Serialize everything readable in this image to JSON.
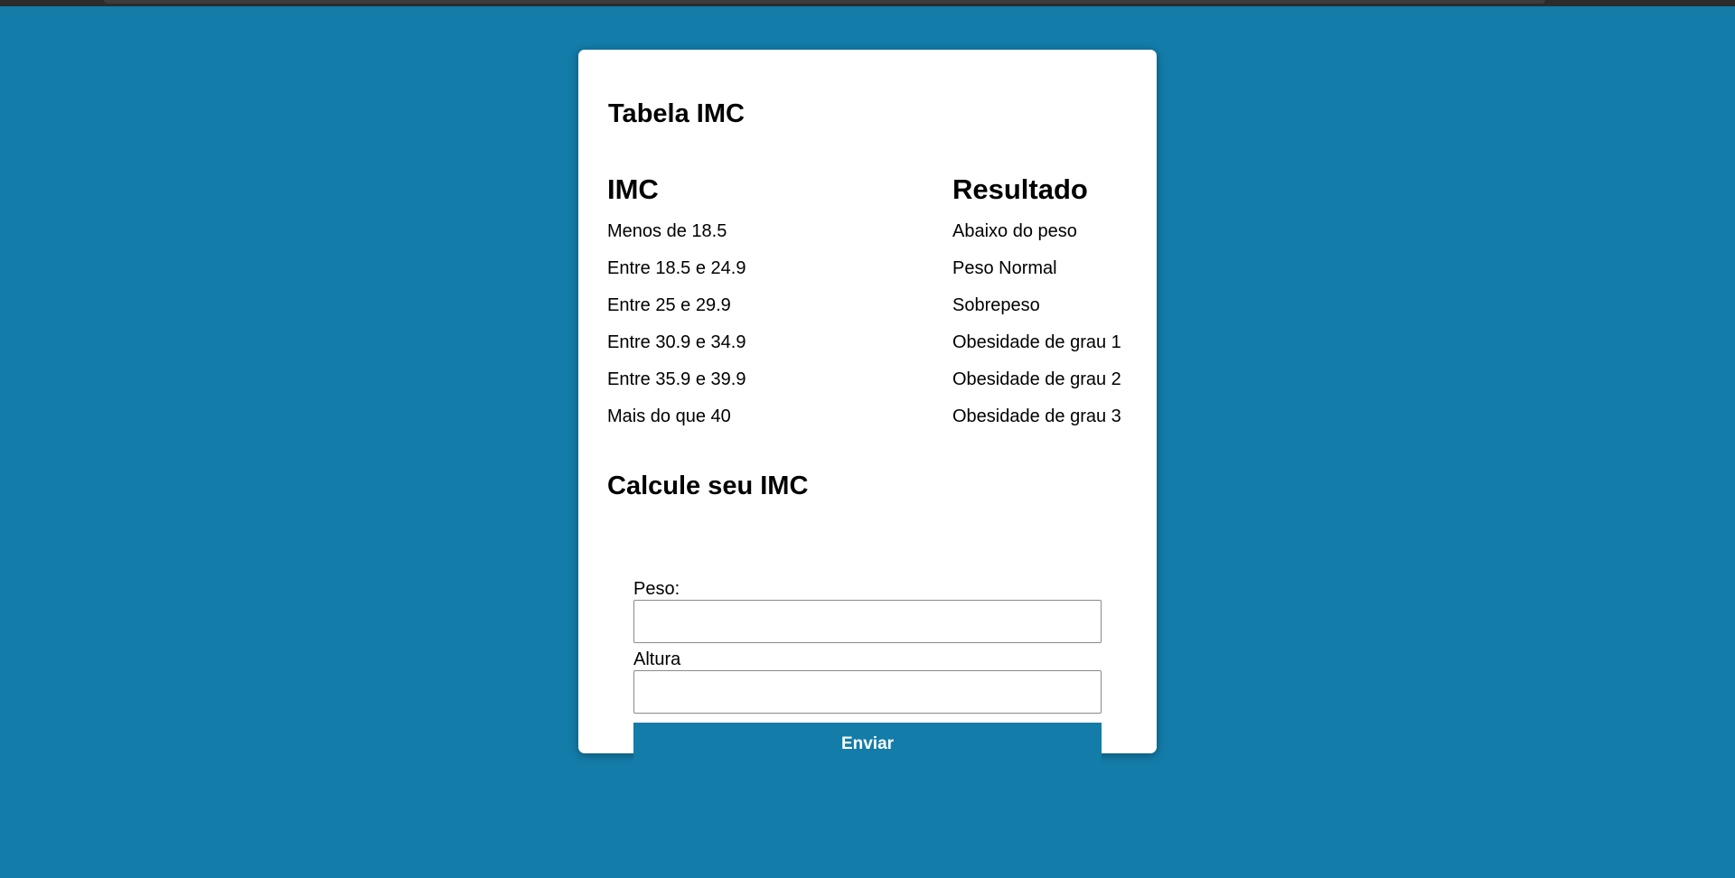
{
  "colors": {
    "background": "#137ca9",
    "card": "#ffffff",
    "button": "#137ca9",
    "button_text": "#ffffff"
  },
  "table": {
    "title": "Tabela IMC",
    "headers": {
      "imc": "IMC",
      "result": "Resultado"
    },
    "rows": [
      {
        "imc": "Menos de 18.5",
        "result": "Abaixo do peso"
      },
      {
        "imc": "Entre 18.5 e 24.9",
        "result": "Peso Normal"
      },
      {
        "imc": "Entre 25 e 29.9",
        "result": "Sobrepeso"
      },
      {
        "imc": "Entre 30.9 e 34.9",
        "result": "Obesidade de grau 1"
      },
      {
        "imc": "Entre 35.9 e 39.9",
        "result": "Obesidade de grau 2"
      },
      {
        "imc": "Mais do que 40",
        "result": "Obesidade de grau 3"
      }
    ]
  },
  "calculator": {
    "title": "Calcule seu IMC",
    "peso_label": "Peso:",
    "peso_value": "",
    "altura_label": "Altura",
    "altura_value": "",
    "submit_label": "Enviar"
  }
}
